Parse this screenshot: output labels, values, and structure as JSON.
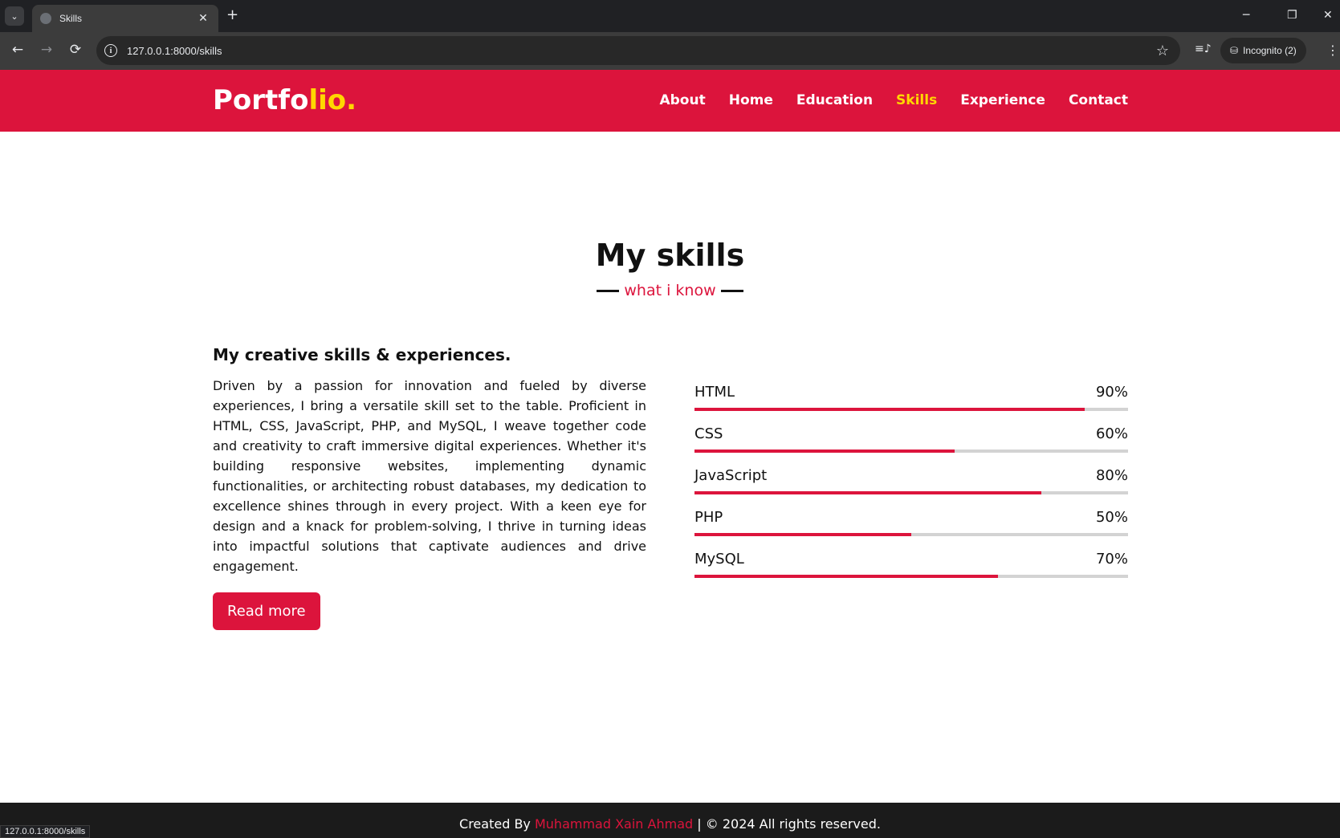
{
  "browser": {
    "tab_title": "Skills",
    "tab_close": "✕",
    "new_tab": "+",
    "url": "127.0.0.1:8000/skills",
    "profile": "Incognito (2)",
    "status_url": "127.0.0.1:8000/skills",
    "icons": {
      "back": "←",
      "forward": "→",
      "reload": "⟳",
      "star": "☆",
      "menu": "⋮",
      "minimize": "─",
      "restore": "❐",
      "close": "✕",
      "tab_search": "⌄",
      "media": "≡♪",
      "incognito": "⛁"
    }
  },
  "header": {
    "logo_main": "Portfo",
    "logo_accent": "lio.",
    "nav": [
      {
        "label": "About"
      },
      {
        "label": "Home"
      },
      {
        "label": "Education"
      },
      {
        "label": "Skills"
      },
      {
        "label": "Experience"
      },
      {
        "label": "Contact"
      }
    ],
    "active_nav": "Skills"
  },
  "section": {
    "title": "My skills",
    "subtitle": "what i know"
  },
  "about": {
    "heading": "My creative skills & experiences.",
    "text": "Driven by a passion for innovation and fueled by diverse experiences, I bring a versatile skill set to the table. Proficient in HTML, CSS, JavaScript, PHP, and MySQL, I weave together code and creativity to craft immersive digital experiences. Whether it's building responsive websites, implementing dynamic functionalities, or architecting robust databases, my dedication to excellence shines through in every project. With a keen eye for design and a knack for problem-solving, I thrive in turning ideas into impactful solutions that captivate audiences and drive engagement.",
    "button": "Read more"
  },
  "skills": [
    {
      "name": "HTML",
      "percent_label": "90%",
      "value": 90
    },
    {
      "name": "CSS",
      "percent_label": "60%",
      "value": 60
    },
    {
      "name": "JavaScript",
      "percent_label": "80%",
      "value": 80
    },
    {
      "name": "PHP",
      "percent_label": "50%",
      "value": 50
    },
    {
      "name": "MySQL",
      "percent_label": "70%",
      "value": 70
    }
  ],
  "footer": {
    "prefix": "Created By",
    "author": "Muhammad Xain Ahmad",
    "suffix": "| © 2024 All rights reserved."
  },
  "colors": {
    "accent": "#dc143c",
    "highlight": "#ffd700",
    "footer_bg": "#1b1b1b"
  }
}
